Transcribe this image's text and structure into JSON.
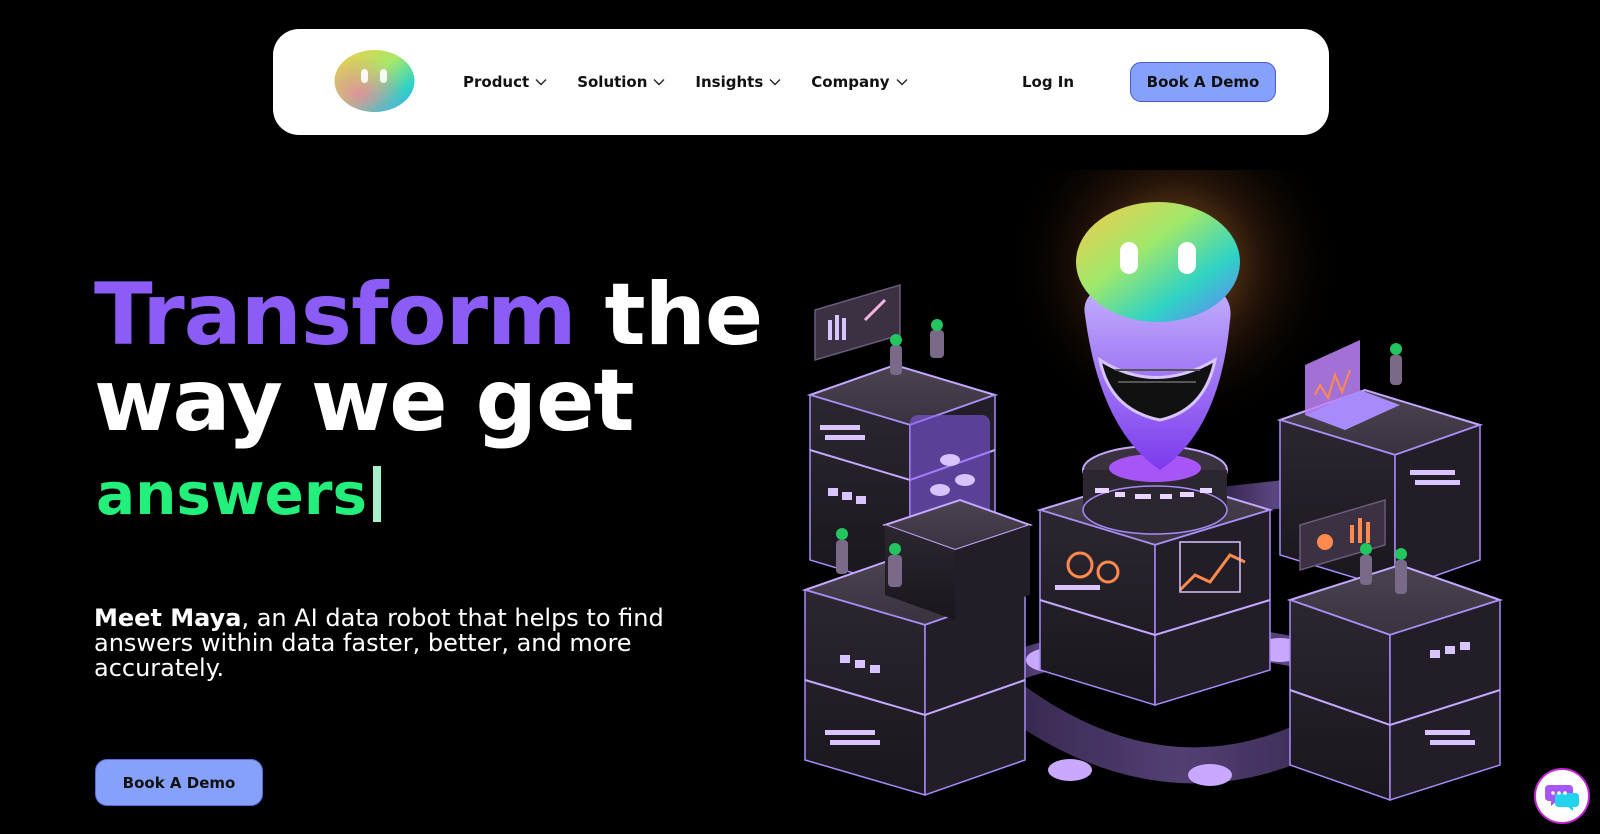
{
  "nav": {
    "items": [
      {
        "label": "Product"
      },
      {
        "label": "Solution"
      },
      {
        "label": "Insights"
      },
      {
        "label": "Company"
      }
    ],
    "login_label": "Log In",
    "demo_label": "Book A Demo"
  },
  "hero": {
    "headline_accent": "Transform",
    "headline_rest_1": " the",
    "headline_line_2": "way we get",
    "typed_word": "answers",
    "sub_strong": "Meet Maya",
    "sub_rest": ", an AI data robot that helps to find answers within data faster, better, and more accurately.",
    "demo_label": "Book A Demo"
  },
  "icons": {
    "logo": "maya-logo-icon",
    "chevron": "chevron-down-icon",
    "chat": "chat-bubble-icon"
  },
  "colors": {
    "background": "#000000",
    "accent_purple": "#8b5cf6",
    "accent_green": "#22f07a",
    "button_blue": "#86a1fb"
  }
}
